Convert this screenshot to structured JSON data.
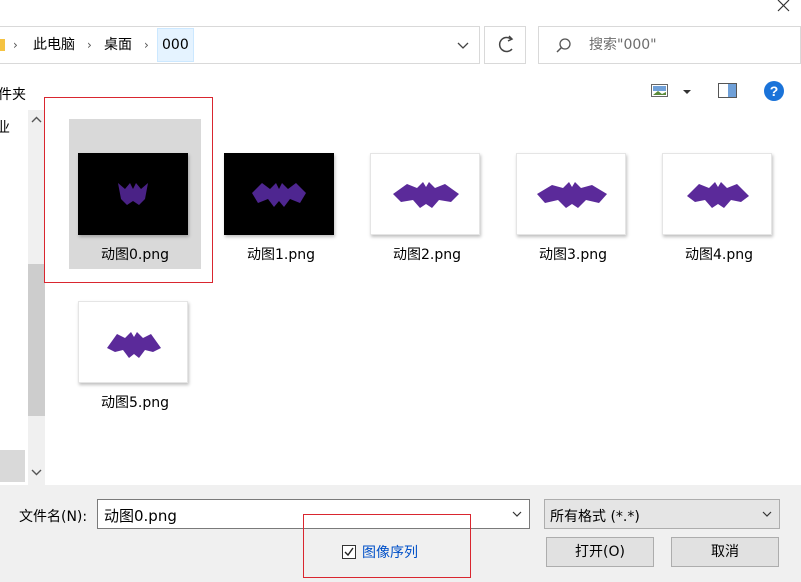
{
  "window": {
    "close_icon": "close-icon"
  },
  "address_bar": {
    "breadcrumbs": [
      "此电脑",
      "桌面",
      "000"
    ],
    "icons": {
      "folder": "folder-icon",
      "separator": "chevron-right-icon",
      "dropdown": "chevron-down-icon",
      "refresh": "refresh-icon"
    }
  },
  "search": {
    "placeholder": "搜索\"000\"",
    "icon": "search-icon"
  },
  "toolbar": {
    "new_folder_label": "件夹",
    "icons": {
      "view": "view-mode-icon",
      "view_dropdown": "chevron-down-icon",
      "preview_pane": "preview-pane-icon",
      "help": "help-icon"
    }
  },
  "nav": {
    "item_label": "业"
  },
  "files": [
    {
      "name": "动图0.png",
      "thumb": "dark",
      "selected": true
    },
    {
      "name": "动图1.png",
      "thumb": "dark",
      "selected": false
    },
    {
      "name": "动图2.png",
      "thumb": "light",
      "selected": false
    },
    {
      "name": "动图3.png",
      "thumb": "light",
      "selected": false
    },
    {
      "name": "动图4.png",
      "thumb": "light",
      "selected": false
    },
    {
      "name": "动图5.png",
      "thumb": "light",
      "selected": false
    }
  ],
  "bottom": {
    "filename_label": "文件名(N):",
    "filename_value": "动图0.png",
    "filetype_value": "所有格式 (*.*)",
    "sequence_label": "图像序列",
    "sequence_checked": true,
    "open_label": "打开(O)",
    "cancel_label": "取消"
  },
  "colors": {
    "accent_link": "#0050c8",
    "annotation": "#d9262f",
    "bat_purple": "#5b2a9a",
    "help_blue": "#1a73d9"
  }
}
